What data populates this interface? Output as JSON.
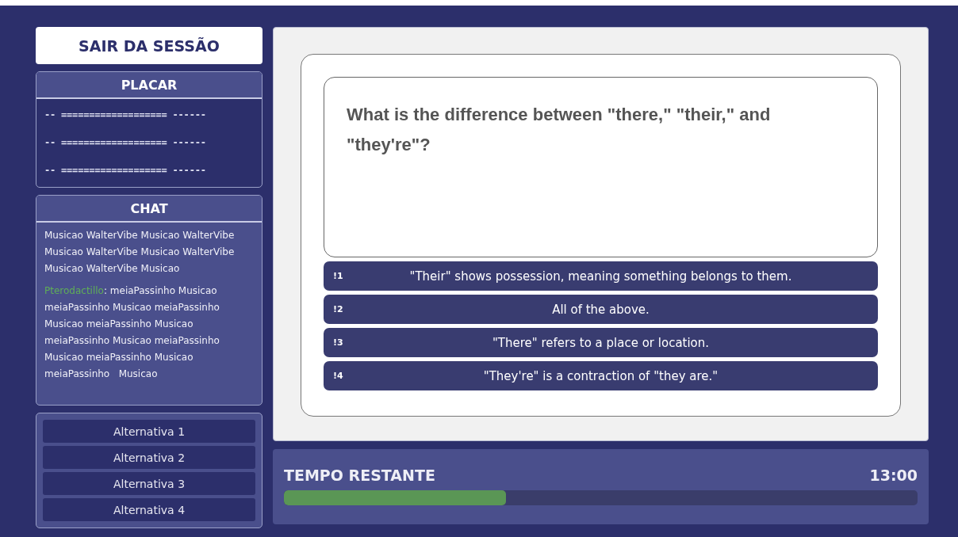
{
  "logout_button": {
    "label": "SAIR DA SESSÃO"
  },
  "scoreboard": {
    "title": "PLACAR",
    "rows": [
      "-- =================== ------",
      "-- =================== ------",
      "-- =================== ------"
    ]
  },
  "chat": {
    "title": "CHAT",
    "messages": [
      {
        "text": "Musicao WalterVibe Musicao WalterVibe Musicao WalterVibe Musicao WalterVibe Musicao WalterVibe Musicao"
      },
      {
        "author": "Pterodactillo",
        "color": "#5fae57",
        "text": ": meiaPassinho Musicao meiaPassinho Musicao meiaPassinho Musicao meiaPassinho Musicao meiaPassinho Musicao meiaPassinho Musicao meiaPassinho Musicao meiaPassinho   Musicao"
      }
    ]
  },
  "alternative_buttons": [
    "Alternativa 1",
    "Alternativa 2",
    "Alternativa 3",
    "Alternativa 4"
  ],
  "question": {
    "text": "What is the difference between \"there,\" \"their,\" and \"they're\"?"
  },
  "answers": [
    {
      "key": "!1",
      "text": "\"Their\" shows possession, meaning something belongs to them."
    },
    {
      "key": "!2",
      "text": "All of the above."
    },
    {
      "key": "!3",
      "text": "\"There\" refers to a place or location."
    },
    {
      "key": "!4",
      "text": "\"They're\" is a contraction of \"they are.\""
    }
  ],
  "timer": {
    "label": "TEMPO RESTANTE",
    "time": "13:00",
    "level": 0.35
  }
}
